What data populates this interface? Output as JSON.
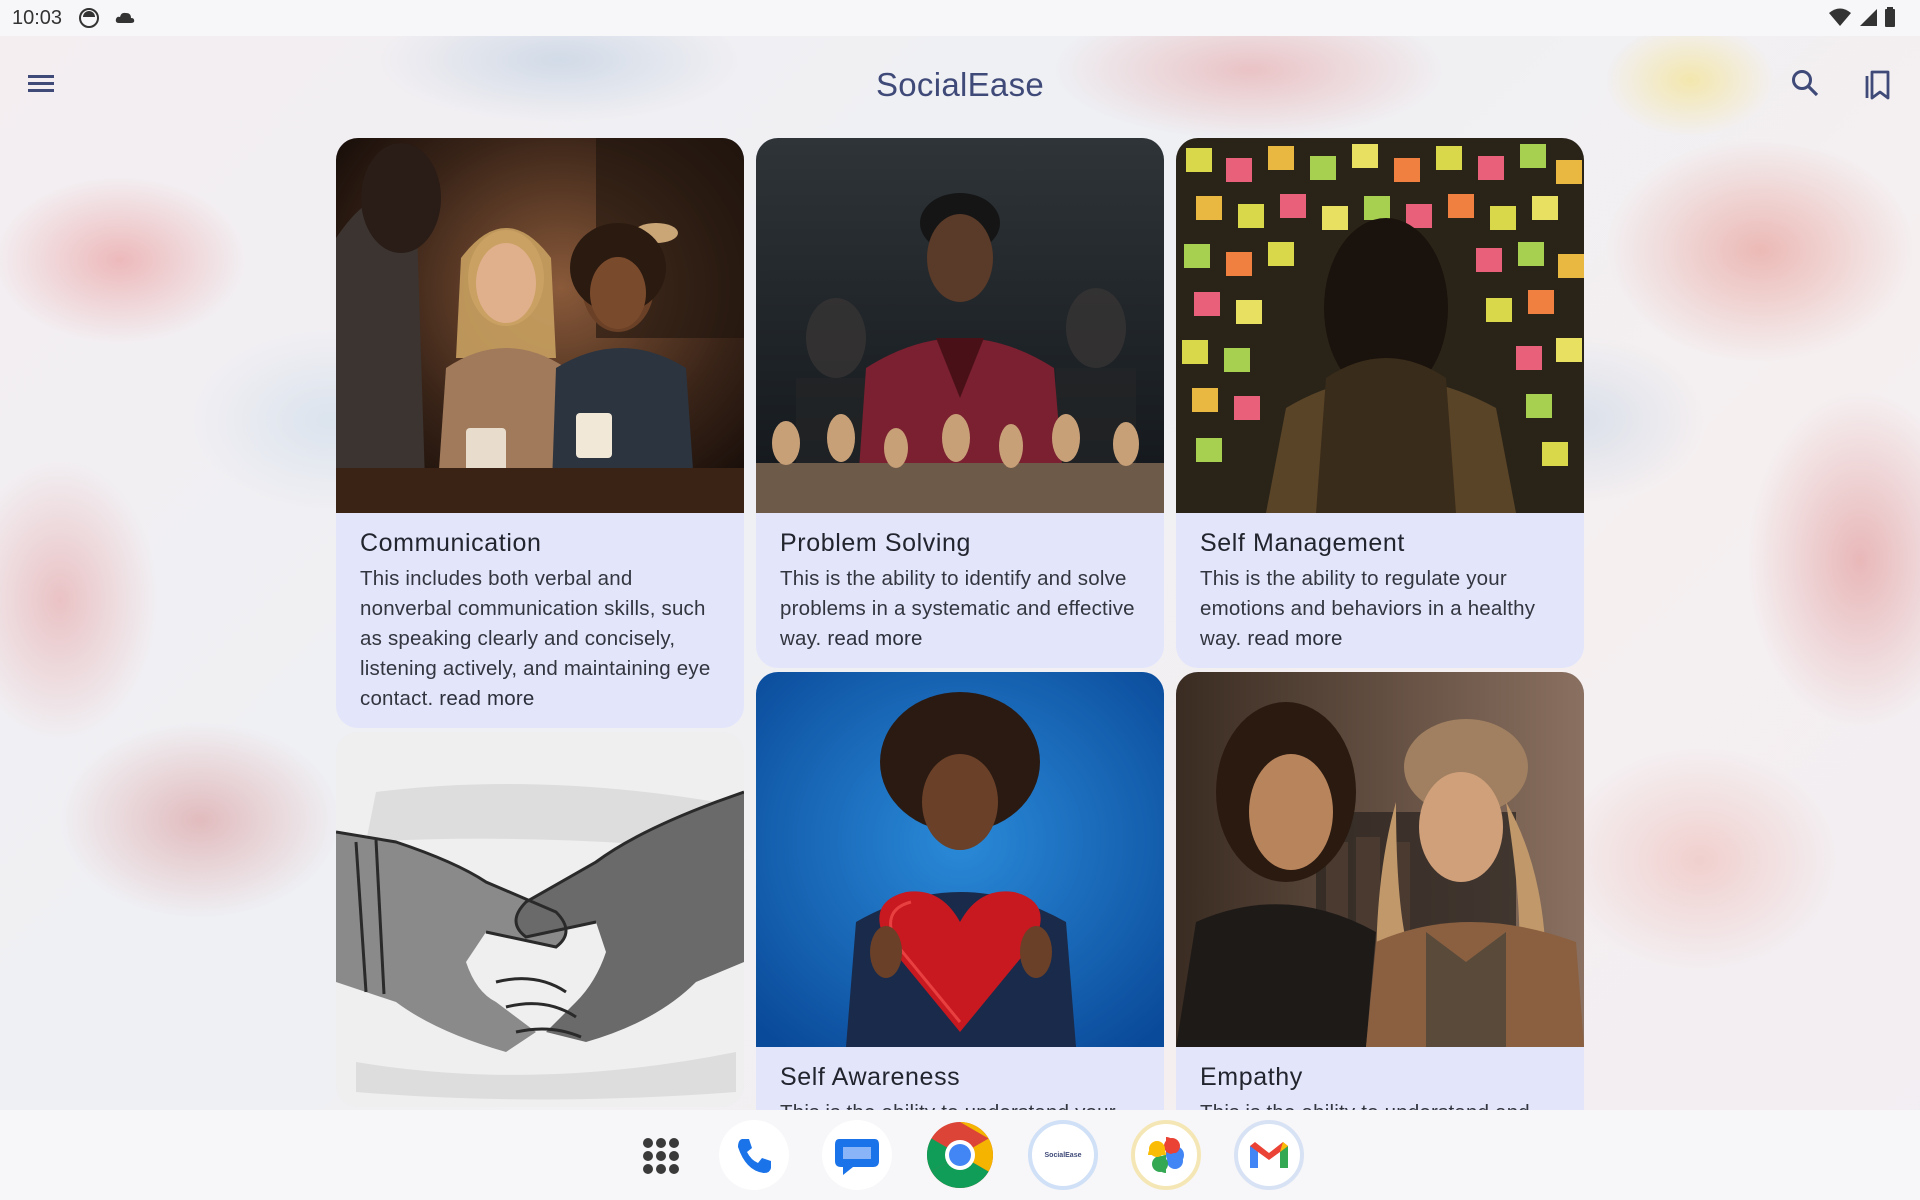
{
  "status_bar": {
    "time": "10:03"
  },
  "app_bar": {
    "title": "SocialEase",
    "menu_icon": "menu-icon",
    "search_icon": "search-icon",
    "bookmarks_icon": "bookmarks-icon"
  },
  "cards": [
    {
      "title": "Communication",
      "description": "This includes both verbal and nonverbal communication skills, such as speaking clearly and concisely, listening actively, and maintaining eye contact.",
      "read_more": "read more",
      "image": "people-talking-over-coffee"
    },
    {
      "title": "Problem Solving",
      "description": "This is the ability to identify and solve problems in a systematic and effective way.",
      "read_more": "read more",
      "image": "man-behind-chess-pieces"
    },
    {
      "title": "Self Management",
      "description": "This is the ability to regulate your emotions and behaviors in a healthy way.",
      "read_more": "read more",
      "image": "woman-facing-sticky-notes-wall"
    },
    {
      "title": "",
      "description": "",
      "read_more": "",
      "image": "handshake-sketch"
    },
    {
      "title": "Self Awareness",
      "description": "This is the ability to understand your",
      "read_more": "",
      "image": "woman-holding-knitted-heart"
    },
    {
      "title": "Empathy",
      "description": "This is the ability to understand and",
      "read_more": "",
      "image": "two-women-talking"
    }
  ],
  "dock": {
    "items": [
      "apps-icon",
      "phone-icon",
      "messages-icon",
      "chrome-icon",
      "socialease-app-icon",
      "photos-icon",
      "gmail-icon"
    ],
    "socialease_label": "SocialEase"
  },
  "colors": {
    "card_background": "#e3e5fb",
    "title": "#3f4a78"
  }
}
